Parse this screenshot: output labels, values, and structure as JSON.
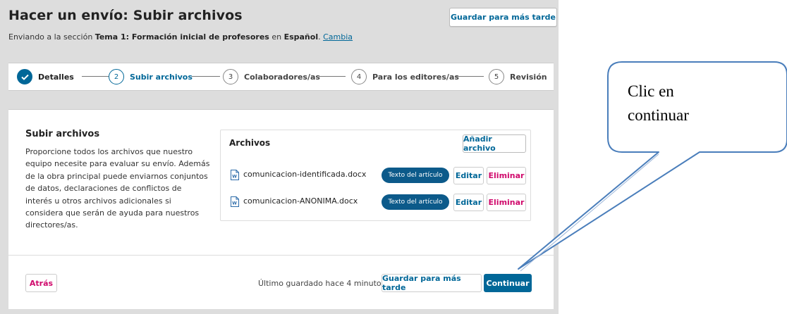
{
  "header": {
    "title": "Hacer un envío: Subir archivos",
    "subtitle_prefix": "Enviando a la sección ",
    "section_name": "Tema 1: Formación inicial de profesores",
    "subtitle_mid": " en ",
    "language": "Español",
    "subtitle_dot": ". ",
    "change_link": "Cambia",
    "save_later": "Guardar para más tarde"
  },
  "steps": [
    {
      "number": "✓",
      "label": "Detalles",
      "state": "done"
    },
    {
      "number": "2",
      "label": "Subir archivos",
      "state": "active"
    },
    {
      "number": "3",
      "label": "Colaboradores/as",
      "state": "pending"
    },
    {
      "number": "4",
      "label": "Para los editores/as",
      "state": "pending"
    },
    {
      "number": "5",
      "label": "Revisión",
      "state": "pending"
    }
  ],
  "upload": {
    "title": "Subir archivos",
    "description": "Proporcione todos los archivos que nuestro equipo necesite para evaluar su envío. Además de la obra principal puede enviarnos conjuntos de datos, declaraciones de conflictos de interés u otros archivos adicionales si considera que serán de ayuda para nuestros directores/as."
  },
  "files": {
    "header": "Archivos",
    "add_button": "Añadir archivo",
    "items": [
      {
        "name": "comunicacion-identificada.docx",
        "type": "Texto del artículo",
        "edit": "Editar",
        "delete": "Eliminar"
      },
      {
        "name": "comunicacion-ANONIMA.docx",
        "type": "Texto del artículo",
        "edit": "Editar",
        "delete": "Eliminar"
      }
    ]
  },
  "footer": {
    "back": "Atrás",
    "last_saved": "Último guardado hace 4 minutos",
    "save_later": "Guardar para más tarde",
    "continue": "Continuar"
  },
  "callout": {
    "line1": "Clic en",
    "line2": "continuar"
  },
  "colors": {
    "primary": "#006798",
    "danger": "#d00a6c",
    "badge": "#0c5a8a",
    "background": "#dddddd",
    "callout_border": "#4a7ebb"
  }
}
